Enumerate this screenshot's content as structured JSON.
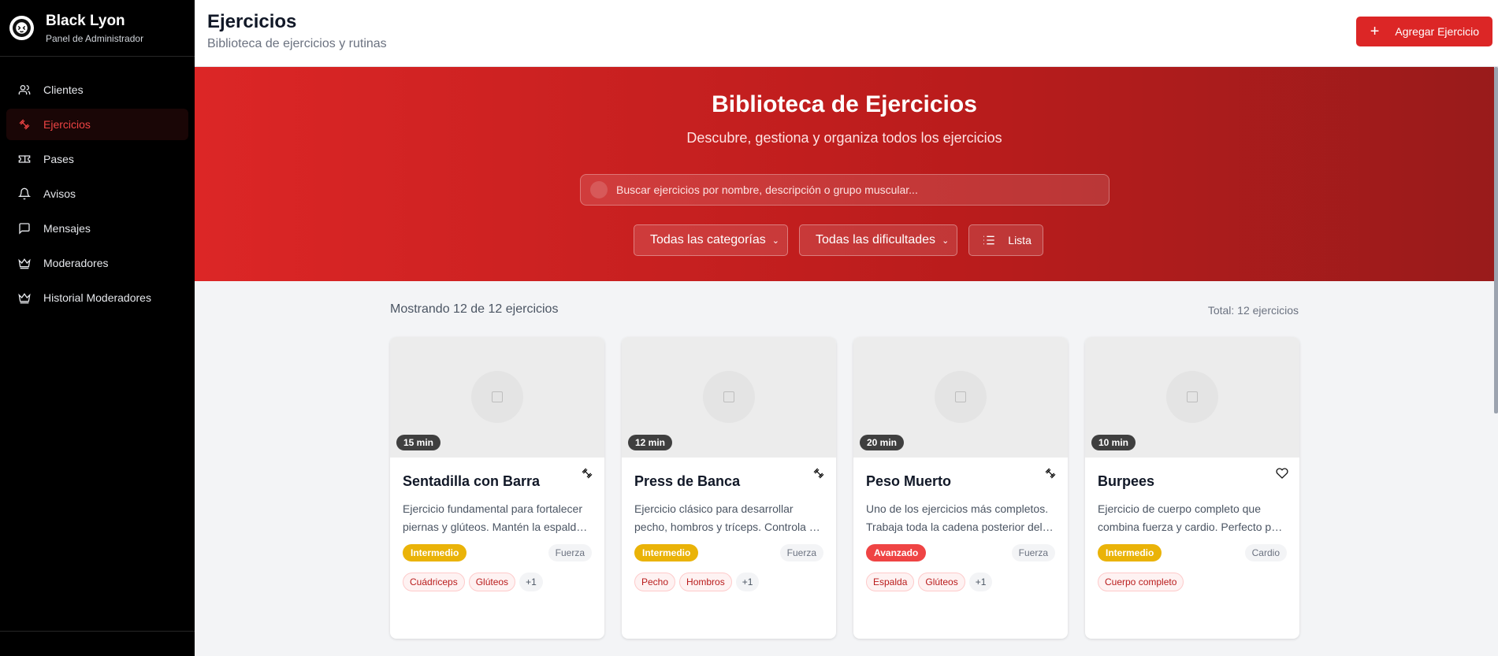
{
  "brand": {
    "title": "Black Lyon",
    "subtitle": "Panel de Administrador"
  },
  "sidebar": {
    "items": [
      {
        "label": "Clientes",
        "icon": "users-icon",
        "active": false
      },
      {
        "label": "Ejercicios",
        "icon": "dumbbell-icon",
        "active": true
      },
      {
        "label": "Pases",
        "icon": "ticket-icon",
        "active": false
      },
      {
        "label": "Avisos",
        "icon": "bell-icon",
        "active": false
      },
      {
        "label": "Mensajes",
        "icon": "message-icon",
        "active": false
      },
      {
        "label": "Moderadores",
        "icon": "crown-icon",
        "active": false
      },
      {
        "label": "Historial Moderadores",
        "icon": "crown-icon",
        "active": false
      }
    ]
  },
  "header": {
    "title": "Ejercicios",
    "subtitle": "Biblioteca de ejercicios y rutinas",
    "add_label": "Agregar Ejercicio"
  },
  "hero": {
    "title": "Biblioteca de Ejercicios",
    "subtitle": "Descubre, gestiona y organiza todos los ejercicios",
    "search_placeholder": "Buscar ejercicios por nombre, descripción o grupo muscular...",
    "category_select": "Todas las categorías",
    "difficulty_select": "Todas las dificultades",
    "view_label": "Lista"
  },
  "summary": {
    "showing": "Mostrando 12 de 12 ejercicios",
    "total": "Total: 12 ejercicios"
  },
  "colors": {
    "accent": "#dc2626",
    "intermedio": "#eab308",
    "avanzado": "#ef4444"
  },
  "cards": [
    {
      "time": "15 min",
      "title": "Sentadilla con Barra",
      "action_icon": "dumbbell-icon",
      "desc1": "Ejercicio fundamental para fortalecer",
      "desc2": "piernas y glúteos. Mantén la espalda recta durante todo el movimiento.",
      "difficulty": "Intermedio",
      "category": "Fuerza",
      "tag1": "Cuádriceps",
      "tag2": "Glúteos",
      "more": "+1"
    },
    {
      "time": "12 min",
      "title": "Press de Banca",
      "action_icon": "dumbbell-icon",
      "desc1": "Ejercicio clásico para desarrollar",
      "desc2": "pecho, hombros y tríceps. Controla el peso en todo momento.",
      "difficulty": "Intermedio",
      "category": "Fuerza",
      "tag1": "Pecho",
      "tag2": "Hombros",
      "more": "+1"
    },
    {
      "time": "20 min",
      "title": "Peso Muerto",
      "action_icon": "dumbbell-icon",
      "desc1": "Uno de los ejercicios más completos.",
      "desc2": "Trabaja toda la cadena posterior del cuerpo.",
      "difficulty": "Avanzado",
      "category": "Fuerza",
      "tag1": "Espalda",
      "tag2": "Glúteos",
      "more": "+1"
    },
    {
      "time": "10 min",
      "title": "Burpees",
      "action_icon": "heart-icon",
      "desc1": "Ejercicio de cuerpo completo que",
      "desc2": "combina fuerza y cardio. Perfecto para quemar calorías.",
      "difficulty": "Intermedio",
      "category": "Cardio",
      "tag1": "Cuerpo completo"
    }
  ]
}
